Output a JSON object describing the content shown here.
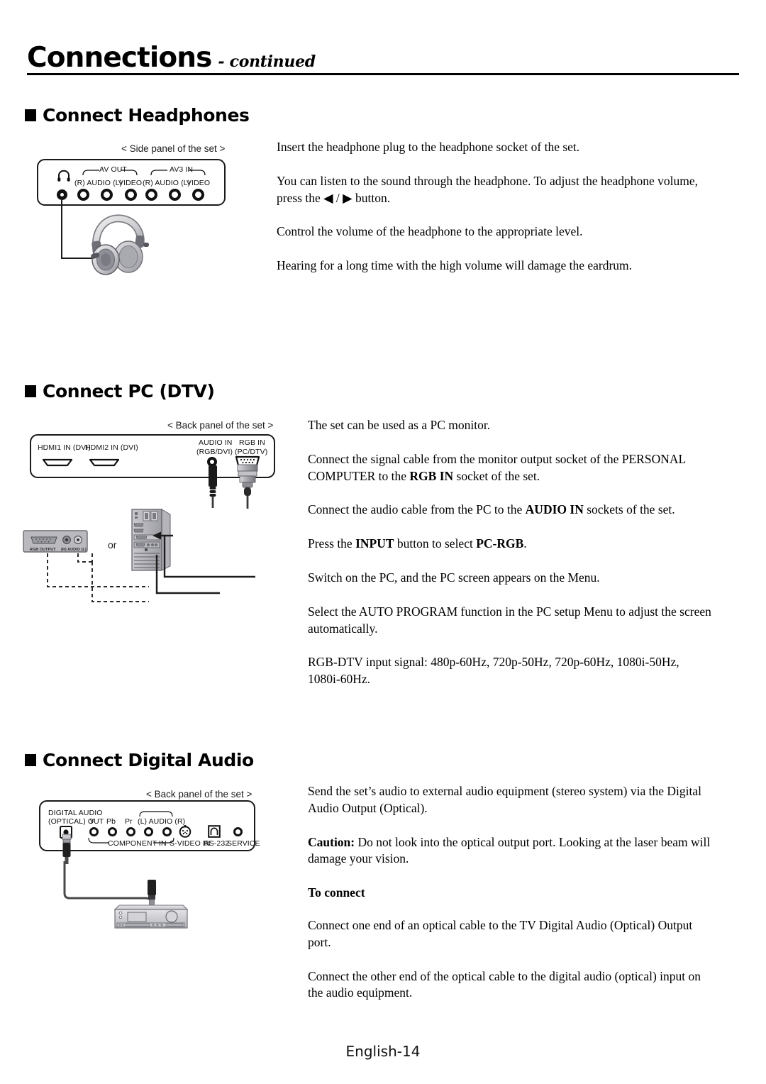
{
  "header": {
    "title": "Connections",
    "subtitle": "- continued"
  },
  "sections": [
    {
      "id": "headphones",
      "heading": "Connect Headphones",
      "diagram": {
        "caption": "< Side panel of the set >",
        "ports": [
          {
            "name": "headphone-jack",
            "label": ""
          },
          {
            "name": "av-out-audio-r",
            "label": "(R) AUDIO (L)"
          },
          {
            "name": "av-out-video",
            "label": "VIDEO"
          },
          {
            "name": "av3-in-audio",
            "label": "(R) AUDIO (L)"
          },
          {
            "name": "av3-in-video",
            "label": "VIDEO"
          }
        ],
        "group_labels": [
          "AV OUT",
          "AV3 IN"
        ],
        "device": "headphones"
      },
      "paragraphs": [
        {
          "text": "Insert the headphone plug to the headphone socket of the set."
        },
        {
          "text": "You can listen to the sound through the headphone. To adjust the headphone volume, press the ◀ / ▶ button."
        },
        {
          "text": "Control the volume of the headphone to the appropriate level."
        },
        {
          "text": "Hearing for a long time with the high volume will damage the eardrum."
        }
      ]
    },
    {
      "id": "pc-dtv",
      "heading": "Connect PC (DTV)",
      "diagram": {
        "caption": "< Back panel of the set >",
        "labels": {
          "hdmi1": "HDMI1 IN (DVI)",
          "hdmi2": "HDMI2 IN (DVI)",
          "audio_in_line1": "AUDIO IN",
          "audio_in_line2": "(RGB/DVI)",
          "rgb_in_line1": "RGB IN",
          "rgb_in_line2": "(PC/DTV)"
        },
        "pc_rear": {
          "rgb_output": "RGB OUTPUT",
          "audio": "(R) AUDIO (L)"
        },
        "or_label": "or",
        "device": "pc-tower"
      },
      "paragraphs": [
        {
          "text": "The set can be used as a PC monitor."
        },
        {
          "html": "Connect the signal cable from the monitor output socket of the PERSONAL COMPUTER to the <b>RGB IN</b> socket of the set."
        },
        {
          "html": "Connect the audio cable from the PC to the <b>AUDIO IN</b> sockets of the set."
        },
        {
          "html": "Press the <b>INPUT</b> button to select <b>PC-RGB</b>."
        },
        {
          "text": "Switch on the PC, and the PC screen appears on the Menu."
        },
        {
          "text": "Select the AUTO PROGRAM function in the PC setup Menu to adjust the screen automatically."
        },
        {
          "text": "RGB-DTV input signal: 480p-60Hz, 720p-50Hz, 720p-60Hz, 1080i-50Hz, 1080i-60Hz."
        }
      ]
    },
    {
      "id": "digital-audio",
      "heading": "Connect Digital Audio",
      "diagram": {
        "caption": "< Back panel of the set >",
        "labels": {
          "digital_audio_line1": "DIGITAL AUDIO",
          "digital_audio_line2": "(OPTICAL) OUT",
          "y": "Y",
          "pb": "Pb",
          "pr": "Pr",
          "audio": "(L) AUDIO (R)",
          "component_in": "COMPONENT IN",
          "s_video_in": "S-VIDEO IN",
          "rs232": "RS-232",
          "service": "SERVICE"
        },
        "device": "stereo-receiver"
      },
      "paragraphs": [
        {
          "text": "Send the set’s audio to external audio equipment (stereo system) via the Digital Audio Output (Optical)."
        },
        {
          "html": "<b>Caution:</b> Do not look into the optical output port. Looking at the laser beam will damage your vision."
        },
        {
          "html": "<b>To connect</b>",
          "bold_heading": true
        },
        {
          "text": "Connect one end of an optical cable to the TV Digital Audio (Optical) Output port."
        },
        {
          "text": "Connect the other end of the optical cable to the digital audio (optical) input on the audio equipment."
        }
      ]
    }
  ],
  "footer": {
    "page_label": "English-14"
  },
  "colors": {
    "ink": "#000000",
    "line": "#1a1a1a",
    "metal_light": "#d7d7da",
    "metal_mid": "#a8a8ad",
    "metal_dark": "#6e6e73",
    "cable_black": "#1b1b1b"
  }
}
